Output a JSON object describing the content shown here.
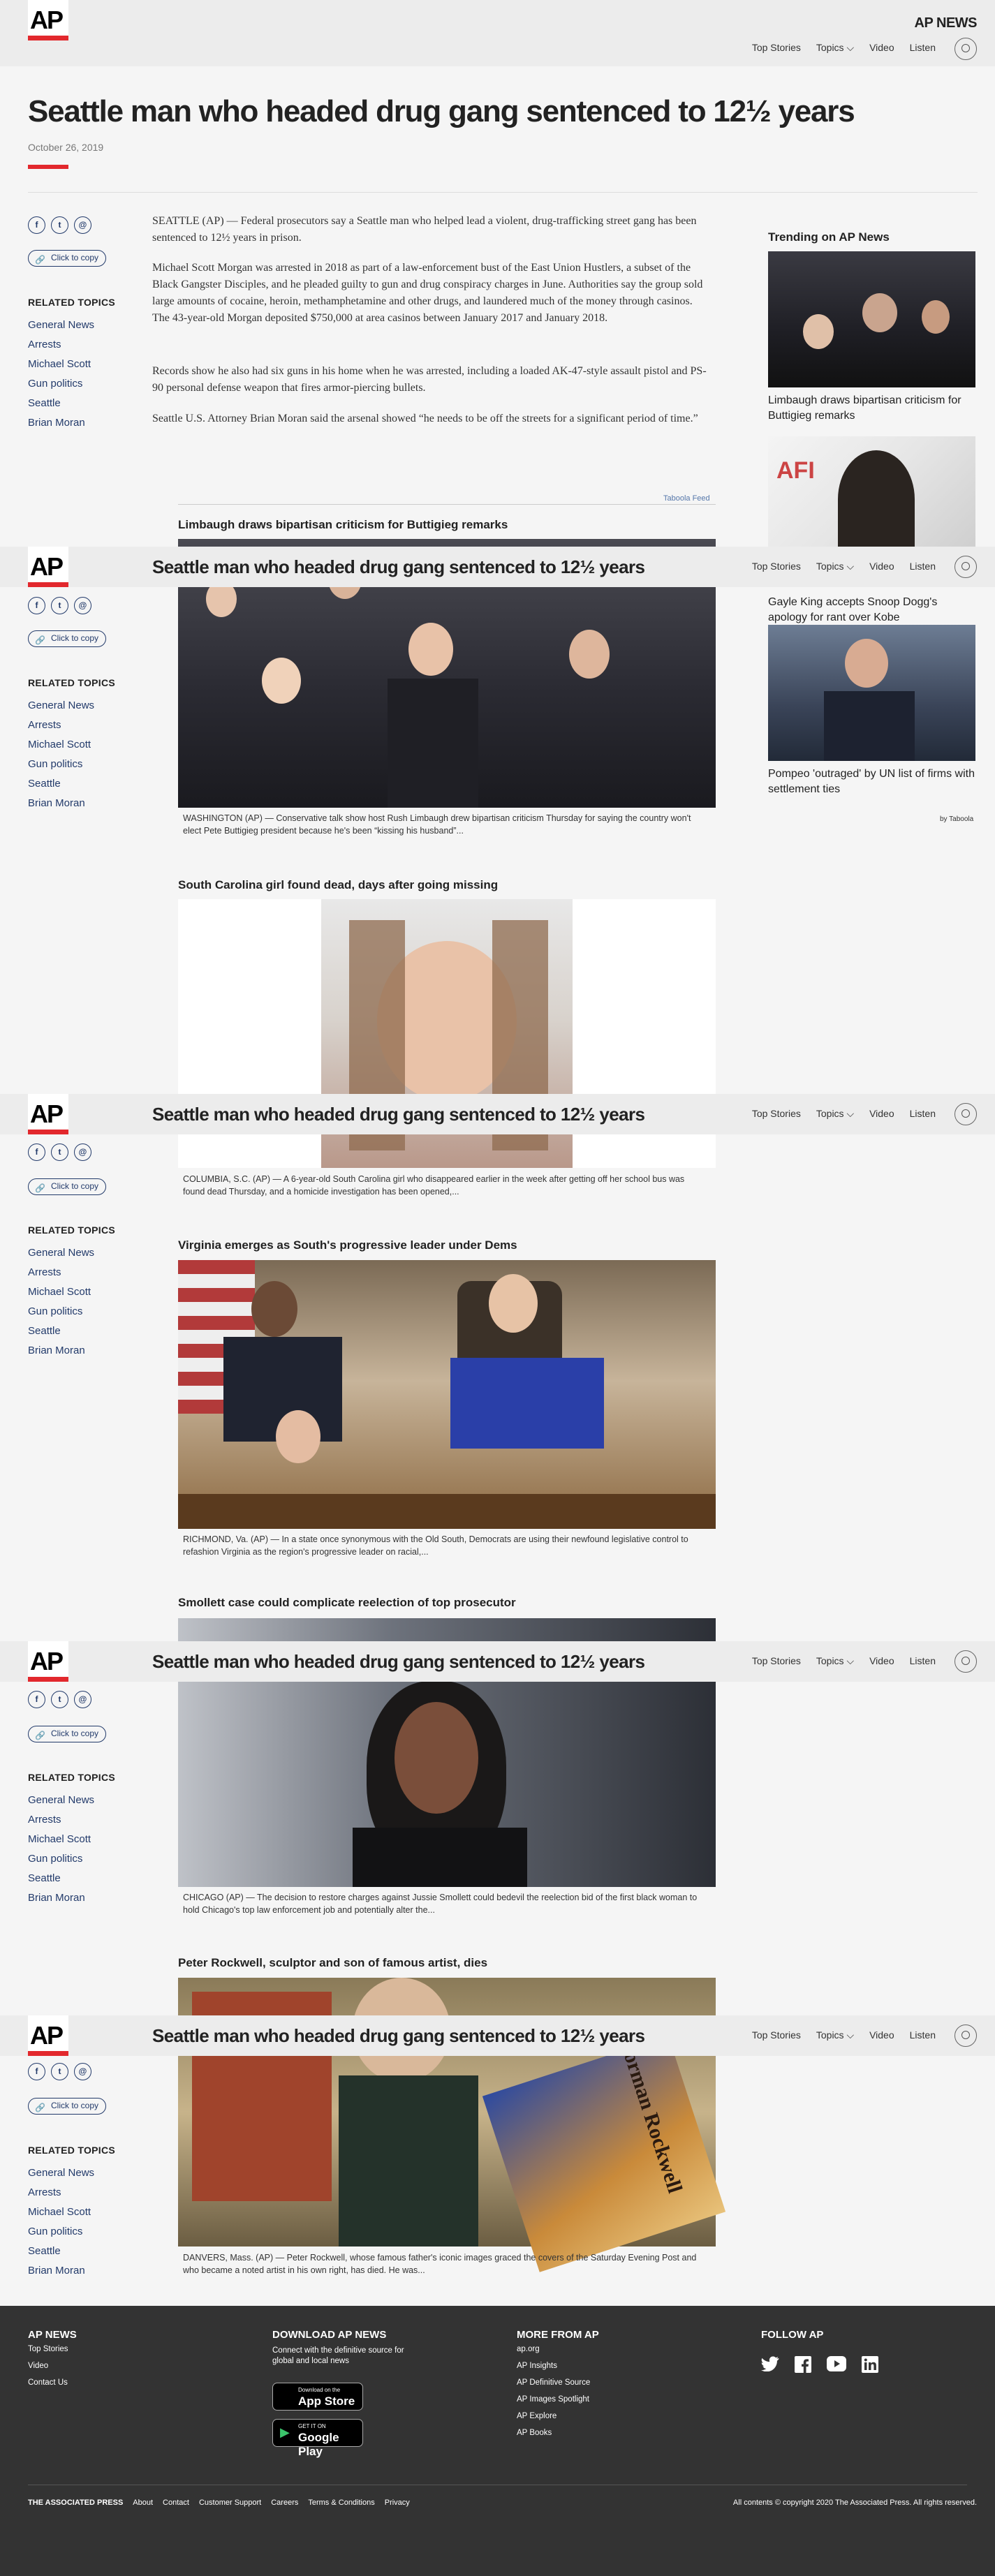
{
  "site": {
    "logo": "AP",
    "brand": "AP NEWS"
  },
  "nav": {
    "links": [
      "Top Stories",
      "Topics",
      "Video",
      "Listen"
    ]
  },
  "article": {
    "title": "Seattle man who headed drug gang sentenced to 12½ years",
    "date": "October 26, 2019",
    "paragraphs": [
      "SEATTLE (AP) — Federal prosecutors say a Seattle man who helped lead a violent, drug-trafficking street gang has been sentenced to 12½ years in prison.",
      "Michael Scott Morgan was arrested in 2018 as part of a law-enforcement bust of the East Union Hustlers, a subset of the Black Gangster Disciples, and he pleaded guilty to gun and drug conspiracy charges in June. Authorities say the group sold large amounts of cocaine, heroin, methamphetamine and other drugs, and laundered much of the money through casinos. The 43-year-old Morgan deposited $750,000 at area casinos between January 2017 and January 2018.",
      "Records show he also had six guns in his home when he was arrested, including a loaded AK-47-style assault pistol and PS-90 personal defense weapon that fires armor-piercing bullets.",
      "Seattle U.S. Attorney Brian Moran said the arsenal showed “he needs to be off the streets for a significant period of time.”"
    ]
  },
  "share": {
    "facebook": "f",
    "twitter": "t",
    "email": "@",
    "copy_label": "Click to copy"
  },
  "related": {
    "heading": "RELATED TOPICS",
    "topics": [
      "General News",
      "Arrests",
      "Michael Scott",
      "Gun politics",
      "Seattle",
      "Brian Moran"
    ]
  },
  "trending": {
    "heading": "Trending on AP News",
    "items": [
      {
        "caption": "Limbaugh draws bipartisan criticism for Buttigieg remarks"
      },
      {
        "caption": "Gayle King accepts Snoop Dogg's apology for rant over Kobe"
      },
      {
        "caption": "Pompeo 'outraged' by UN list of firms with settlement ties"
      }
    ],
    "by": "by Taboola"
  },
  "feed": {
    "label": "Taboola Feed",
    "items": [
      {
        "title": "Limbaugh draws bipartisan criticism for Buttigieg remarks",
        "caption": "WASHINGTON (AP) — Conservative talk show host Rush Limbaugh drew bipartisan criticism Thursday for saying the country won't elect Pete Buttigieg president because he's been “kissing his husband”..."
      },
      {
        "title": "South Carolina girl found dead, days after going missing",
        "caption": "COLUMBIA, S.C. (AP) — A 6-year-old South Carolina girl who disappeared earlier in the week after getting off her school bus was found dead Thursday, and a homicide investigation has been opened,..."
      },
      {
        "title": "Virginia emerges as South's progressive leader under Dems",
        "caption": "RICHMOND, Va. (AP) — In a state once synonymous with the Old South, Democrats are using their newfound legislative control to refashion Virginia as the region's progressive leader on racial,..."
      },
      {
        "title": "Smollett case could complicate reelection of top prosecutor",
        "caption": "CHICAGO (AP) — The decision to restore charges against Jussie Smollett could bedevil the reelection bid of the first black woman to hold Chicago's top law enforcement job and potentially alter the..."
      },
      {
        "title": "Peter Rockwell, sculptor and son of famous artist, dies",
        "caption": "DANVERS, Mass. (AP) — Peter Rockwell, whose famous father's iconic images graced the covers of the Saturday Evening Post and who became a noted artist in his own right, has died. He was..."
      }
    ],
    "book_title": "Norman Rockwell"
  },
  "footer": {
    "col1": {
      "heading": "AP NEWS",
      "links": [
        "Top Stories",
        "Video",
        "Contact Us"
      ]
    },
    "col2": {
      "heading": "DOWNLOAD AP NEWS",
      "text": "Connect with the definitive source for global and local news",
      "appstore_small": "Download on the",
      "appstore": "App Store",
      "gplay_small": "GET IT ON",
      "gplay": "Google Play"
    },
    "col3": {
      "heading": "MORE FROM AP",
      "links": [
        "ap.org",
        "AP Insights",
        "AP Definitive Source",
        "AP Images Spotlight",
        "AP Explore",
        "AP Books"
      ]
    },
    "col4": {
      "heading": "FOLLOW AP"
    },
    "bottom_links": [
      "THE ASSOCIATED PRESS",
      "About",
      "Contact",
      "Customer Support",
      "Careers",
      "Terms & Conditions",
      "Privacy"
    ],
    "copyright": "All contents © copyright 2020 The Associated Press. All rights reserved."
  },
  "colors": {
    "accent": "#e2282d",
    "link": "#223a6a",
    "footer_bg": "#333333"
  }
}
